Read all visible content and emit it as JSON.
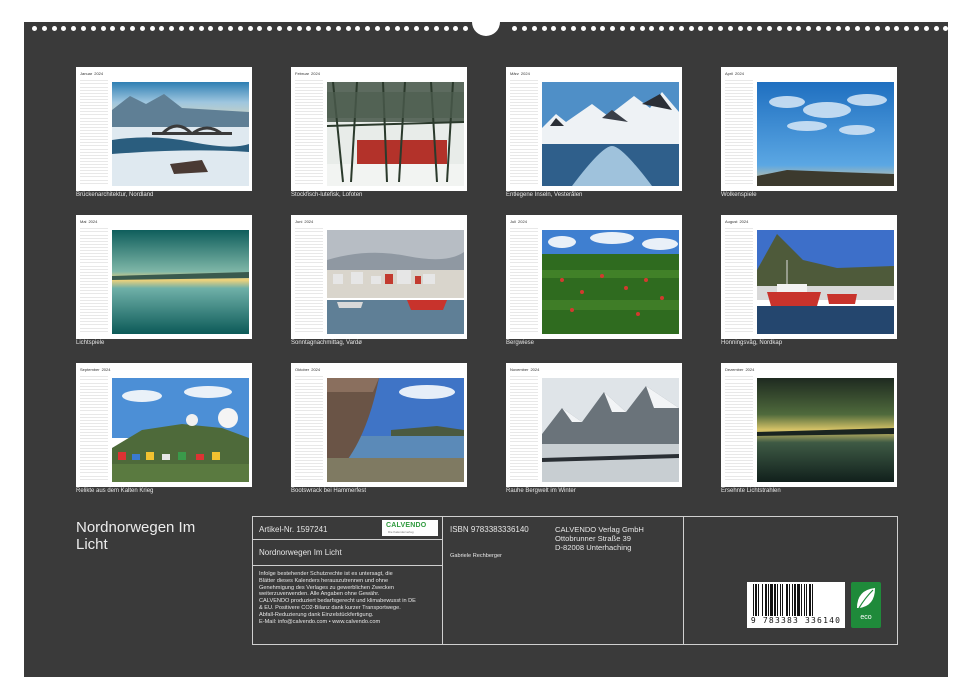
{
  "year": "2024",
  "months": [
    {
      "name": "Januar",
      "caption": "Brückenarchitektur, Nordland"
    },
    {
      "name": "Februar",
      "caption": "Stockfisch-lutefisk, Lofoten"
    },
    {
      "name": "März",
      "caption": "Entlegene Inseln, Vesterålen"
    },
    {
      "name": "April",
      "caption": "Wolkenspiele"
    },
    {
      "name": "Mai",
      "caption": "Lichtspiele"
    },
    {
      "name": "Juni",
      "caption": "Sonntagnachmittag, Vardø"
    },
    {
      "name": "Juli",
      "caption": "Bergwiese"
    },
    {
      "name": "August",
      "caption": "Honningsvåg, Nordkap"
    },
    {
      "name": "September",
      "caption": "Relikte aus dem Kalten Krieg"
    },
    {
      "name": "Oktober",
      "caption": "Bootswrack bei Hammerfest"
    },
    {
      "name": "November",
      "caption": "Rauhe Bergwelt im Winter"
    },
    {
      "name": "Dezember",
      "caption": "Ersehnte Lichtstrahlen"
    }
  ],
  "cover_title": "Nordnorwegen Im Licht",
  "info": {
    "article": "Artikel-Nr. 1597241",
    "logo_text": "CALVENDO",
    "logo_sub": "Die Kalenderverlag",
    "product_title": "Nordnorwegen Im Licht",
    "legal": [
      "Infolge bestehender Schutzrechte ist es untersagt, die",
      "Blätter dieses Kalenders herauszutrennen und ohne",
      "Genehmigung des Verlages zu gewerblichen Zwecken",
      "weiterzuverwenden. Alle Angaben ohne Gewähr.",
      "CALVENDO produziert bedarfsgerecht und klimabewusst in DE",
      "& EU. Positivere CO2-Bilanz dank kurzer Transportwege.",
      "Abfall-Reduzierung dank Einzelstückfertigung.",
      "E-Mail: info@calvendo.com • www.calvendo.com"
    ],
    "isbn": "ISBN 9783383336140",
    "author": "Gabriele Rechberger",
    "publisher": [
      "CALVENDO Verlag GmbH",
      "Ottobrunner Straße 39",
      "D-82008 Unterhaching"
    ],
    "barcode_number": "9 783383 336140",
    "eco_label": "eco"
  }
}
